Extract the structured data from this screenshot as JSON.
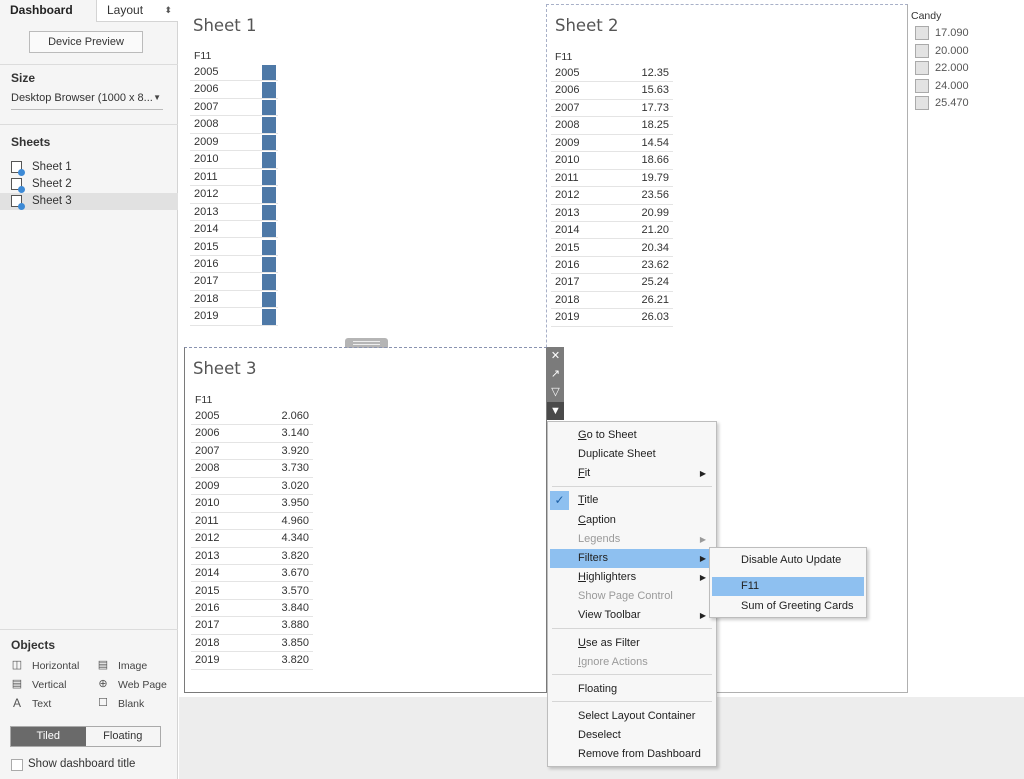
{
  "left_panel": {
    "tabs": [
      "Dashboard",
      "Layout"
    ],
    "device_preview": "Device Preview",
    "size_heading": "Size",
    "size_value": "Desktop Browser (1000 x 8...",
    "sheets_heading": "Sheets",
    "sheets": [
      "Sheet 1",
      "Sheet 2",
      "Sheet 3"
    ],
    "objects_heading": "Objects",
    "objects": [
      {
        "label": "Horizontal",
        "icon": "horizontal-layout-icon"
      },
      {
        "label": "Image",
        "icon": "image-icon"
      },
      {
        "label": "Vertical",
        "icon": "vertical-layout-icon"
      },
      {
        "label": "Web Page",
        "icon": "globe-icon"
      },
      {
        "label": "Text",
        "icon": "text-icon"
      },
      {
        "label": "Blank",
        "icon": "blank-icon"
      }
    ],
    "mode_tiled": "Tiled",
    "mode_floating": "Floating",
    "show_title": "Show dashboard title"
  },
  "sheet1": {
    "title": "Sheet 1",
    "col_header": "F11",
    "years": [
      "2005",
      "2006",
      "2007",
      "2008",
      "2009",
      "2010",
      "2011",
      "2012",
      "2013",
      "2014",
      "2015",
      "2016",
      "2017",
      "2018",
      "2019"
    ]
  },
  "sheet2": {
    "title": "Sheet 2",
    "col_header": "F11",
    "years": [
      "2005",
      "2006",
      "2007",
      "2008",
      "2009",
      "2010",
      "2011",
      "2012",
      "2013",
      "2014",
      "2015",
      "2016",
      "2017",
      "2018",
      "2019"
    ],
    "values": [
      "12.35",
      "15.63",
      "17.73",
      "18.25",
      "14.54",
      "18.66",
      "19.79",
      "23.56",
      "20.99",
      "21.20",
      "20.34",
      "23.62",
      "25.24",
      "26.21",
      "26.03"
    ]
  },
  "sheet3": {
    "title": "Sheet 3",
    "col_header": "F11",
    "years": [
      "2005",
      "2006",
      "2007",
      "2008",
      "2009",
      "2010",
      "2011",
      "2012",
      "2013",
      "2014",
      "2015",
      "2016",
      "2017",
      "2018",
      "2019"
    ],
    "values": [
      "2.060",
      "3.140",
      "3.920",
      "3.730",
      "3.020",
      "3.950",
      "4.960",
      "4.340",
      "3.820",
      "3.670",
      "3.570",
      "3.840",
      "3.880",
      "3.850",
      "3.820"
    ]
  },
  "legend": {
    "title": "Candy",
    "items": [
      "17.090",
      "20.000",
      "22.000",
      "24.000",
      "25.470"
    ]
  },
  "context_menu": {
    "items": [
      {
        "label": "Go to Sheet",
        "ul": "G",
        "rest": "o to Sheet"
      },
      {
        "label": "Duplicate Sheet",
        "ul": "",
        "rest": "Duplicate Sheet"
      },
      {
        "label": "Fit",
        "ul": "F",
        "rest": "it",
        "sub": true
      },
      {
        "label": "Title",
        "ul": "T",
        "rest": "itle",
        "checked": true
      },
      {
        "label": "Caption",
        "ul": "C",
        "rest": "aption"
      },
      {
        "label": "Legends",
        "ul": "",
        "rest": "Legends",
        "disabled": true,
        "sub": true
      },
      {
        "label": "Filters",
        "ul": "",
        "rest": "Filters",
        "sub": true,
        "highlighted": true
      },
      {
        "label": "Highlighters",
        "ul": "H",
        "rest": "ighlighters",
        "sub": true
      },
      {
        "label": "Show Page Control",
        "ul": "",
        "rest": "Show Page Control",
        "disabled": true
      },
      {
        "label": "View Toolbar",
        "ul": "",
        "rest": "View Toolbar",
        "sub": true
      },
      {
        "label": "Use as Filter",
        "ul": "U",
        "rest": "se as Filter"
      },
      {
        "label": "Ignore Actions",
        "ul": "I",
        "rest": "gnore Actions",
        "disabled": true
      },
      {
        "label": "Floating",
        "ul": "",
        "rest": "Floating"
      },
      {
        "label": "Select Layout Container",
        "ul": "",
        "rest": "Select Layout Container"
      },
      {
        "label": "Deselect",
        "ul": "",
        "rest": "Deselect"
      },
      {
        "label": "Remove from Dashboard",
        "ul": "",
        "rest": "Remove from Dashboard"
      }
    ]
  },
  "submenu": {
    "items": [
      "Disable Auto Update",
      "F11",
      "Sum of Greeting Cards"
    ],
    "highlighted": "F11"
  },
  "colors": {
    "bar": "#4e79a7",
    "menu_highlight": "#8ec0f0",
    "panel_bg": "#f5f5f5"
  }
}
